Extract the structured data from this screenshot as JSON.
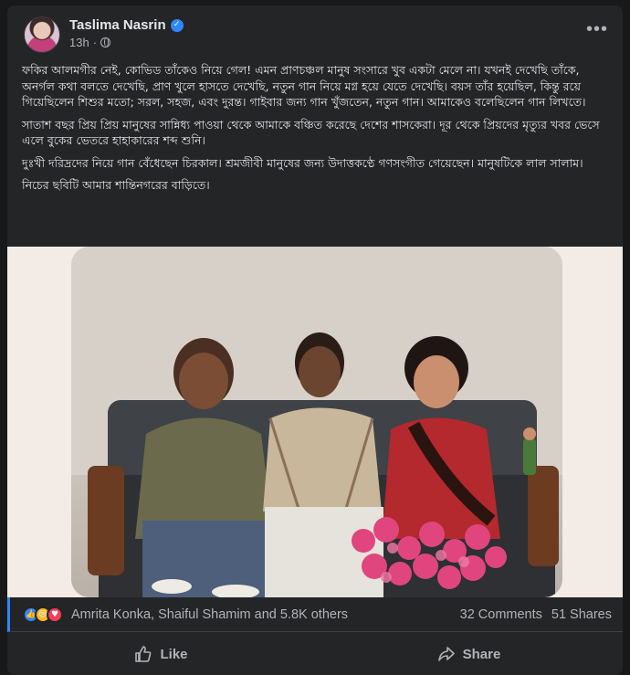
{
  "post": {
    "author": "Taslima Nasrin",
    "time": "13h",
    "paragraphs": [
      "ফকির আলমগীর নেই, কোভিড তাঁকেও নিয়ে গেল! এমন প্রাণচঞ্চল মানুষ সংসারে খুব একটা মেলে না। যখনই দেখেছি তাঁকে, অনর্গল কথা বলতে দেখেছি, প্রাণ খুলে হাসতে দেখেছি, নতুন গান নিয়ে মগ্ন হয়ে যেতে দেখেছি। বয়স তাঁর হয়েছিল, কিন্তু রয়ে গিয়েছিলেন শিশুর মতো; সরল, সহজ, এবং দুরন্ত। গাইবার জন্য গান খুঁজতেন, নতুন গান। আমাকেও বলেছিলেন গান লিখতে।",
      "সাতাশ বছর প্রিয় প্রিয় মানুষের সান্নিধ্য পাওয়া থেকে আমাকে বঞ্চিত করেছে দেশের শাসকেরা। দূর থেকে প্রিয়দের মৃত্যুর খবর ভেসে এলে বুকের ভেতরে হাহাকারের শব্দ শুনি।",
      "দুঃখী দরিদ্রদের নিয়ে গান বেঁধেছেন চিরকাল। শ্রমজীবী মানুষের জন্য উদাত্তকণ্ঠে গণসংগীত গেয়েছেন। মানুষটিকে লাল সালাম।",
      "নিচের ছবিটি আমার শান্তিনগরের বাড়িতে।"
    ]
  },
  "reactions": {
    "summary": "Amrita Konka, Shaiful Shamim and 5.8K others",
    "comments": "32 Comments",
    "shares": "51 Shares"
  },
  "actions": {
    "like": "Like",
    "share": "Share"
  },
  "icons": {
    "verified": "verified-badge-icon",
    "audience": "globe-icon",
    "more": "more-options-icon",
    "like": "thumbs-up-icon",
    "share": "share-arrow-icon"
  },
  "colors": {
    "background": "#18191a",
    "card": "#242526",
    "accent": "#2d88ff",
    "secondary_text": "#b0b3b8"
  }
}
